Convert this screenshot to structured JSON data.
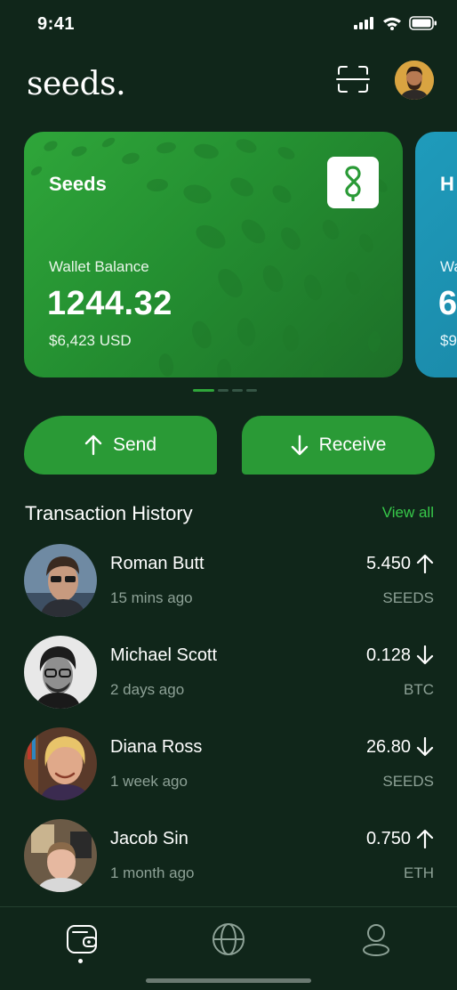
{
  "status_bar": {
    "time": "9:41"
  },
  "header": {
    "logo": "seeds.",
    "scan_icon": "scan-icon",
    "avatar_icon": "user-avatar"
  },
  "cards": [
    {
      "title": "Seeds",
      "label": "Wallet Balance",
      "balance": "1244.32",
      "fiat": "$6,423 USD",
      "logo_icon": "seeds-logo-icon",
      "color": "#2fa63a"
    },
    {
      "title": "H",
      "label": "Wa",
      "balance": "6",
      "fiat": "$9",
      "color": "#1f9bbb"
    }
  ],
  "actions": {
    "send_label": "Send",
    "send_icon": "arrow-up-icon",
    "receive_label": "Receive",
    "receive_icon": "arrow-down-icon"
  },
  "history": {
    "title": "Transaction History",
    "view_all": "View all",
    "transactions": [
      {
        "name": "Roman Butt",
        "time": "15 mins ago",
        "amount": "5.450",
        "direction": "up",
        "coin": "SEEDS"
      },
      {
        "name": "Michael Scott",
        "time": "2 days ago",
        "amount": "0.128",
        "direction": "down",
        "coin": "BTC"
      },
      {
        "name": "Diana Ross",
        "time": "1 week ago",
        "amount": "26.80",
        "direction": "down",
        "coin": "SEEDS"
      },
      {
        "name": "Jacob Sin",
        "time": "1 month ago",
        "amount": "0.750",
        "direction": "up",
        "coin": "ETH"
      }
    ]
  },
  "nav": {
    "items": [
      {
        "icon": "wallet-icon",
        "active": true
      },
      {
        "icon": "globe-icon",
        "active": false
      },
      {
        "icon": "profile-icon",
        "active": false
      }
    ]
  },
  "colors": {
    "background": "#10261a",
    "accent": "#2fa63a",
    "link": "#37c94a",
    "muted": "#8da196"
  }
}
